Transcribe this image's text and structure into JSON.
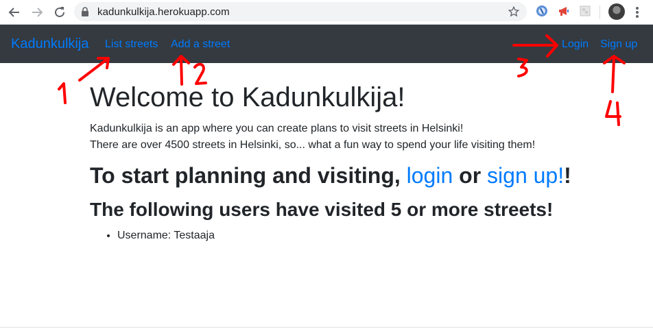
{
  "browser": {
    "url": "kadunkulkija.herokuapp.com",
    "back_icon": "arrow-left-icon",
    "forward_icon": "arrow-right-icon",
    "reload_icon": "reload-icon",
    "lock_icon": "lock-icon",
    "bookmark_icon": "star-icon",
    "menu_icon": "kebab-menu-icon"
  },
  "navbar": {
    "brand": "Kadunkulkija",
    "links": {
      "list_streets": "List streets",
      "add_street": "Add a street",
      "login": "Login",
      "signup": "Sign up"
    },
    "background": "#343a40",
    "link_color": "#007bff"
  },
  "main": {
    "title": "Welcome to Kadunkulkija!",
    "intro_line1": "Kadunkulkija is an app where you can create plans to visit streets in Helsinki!",
    "intro_line2": "There are over 4500 streets in Helsinki, so... what a fun way to spend your life visiting them!",
    "cta_prefix": "To start planning and visiting, ",
    "cta_login": "login",
    "cta_middle": " or ",
    "cta_signup": "sign up!",
    "cta_suffix": "!",
    "users_heading": "The following users have visited 5 or more streets!",
    "users": [
      "Username: Testaaja"
    ]
  },
  "annotations": {
    "color": "#ff0000",
    "labels": [
      "1",
      "2",
      "3",
      "4"
    ]
  }
}
